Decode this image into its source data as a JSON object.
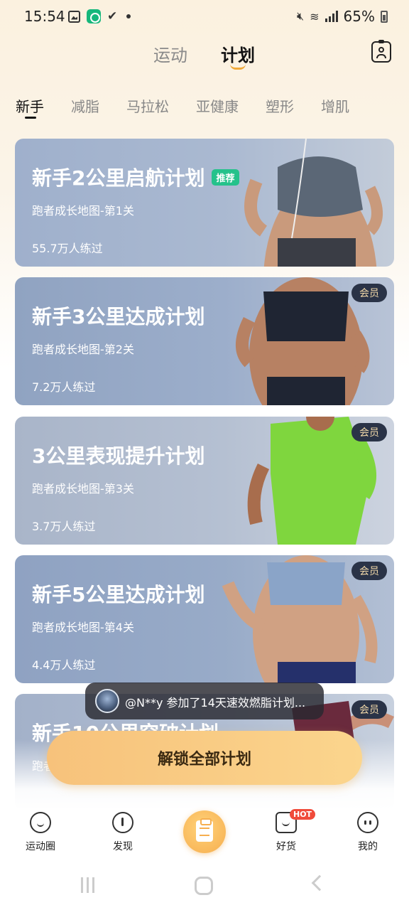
{
  "status_bar": {
    "time": "15:54",
    "battery": "65%",
    "icons_left": [
      "gallery-icon",
      "app-icon",
      "check-icon",
      "dot-icon"
    ],
    "icons_right": [
      "mute-icon",
      "wifi-icon",
      "signal-icon",
      "battery-icon"
    ]
  },
  "header": {
    "tabs": [
      {
        "label": "运动",
        "active": false
      },
      {
        "label": "计划",
        "active": true
      }
    ],
    "profile_icon": "profile-card-icon"
  },
  "categories": [
    {
      "label": "新手",
      "active": true
    },
    {
      "label": "减脂",
      "active": false
    },
    {
      "label": "马拉松",
      "active": false
    },
    {
      "label": "亚健康",
      "active": false
    },
    {
      "label": "塑形",
      "active": false
    },
    {
      "label": "增肌",
      "active": false
    }
  ],
  "plans": [
    {
      "title": "新手2公里启航计划",
      "tag": "推荐",
      "subtitle": "跑者成长地图-第1关",
      "count": "55.7万人练过",
      "badge": ""
    },
    {
      "title": "新手3公里达成计划",
      "tag": "",
      "subtitle": "跑者成长地图-第2关",
      "count": "7.2万人练过",
      "badge": "会员"
    },
    {
      "title": "3公里表现提升计划",
      "tag": "",
      "subtitle": "跑者成长地图-第3关",
      "count": "3.7万人练过",
      "badge": "会员"
    },
    {
      "title": "新手5公里达成计划",
      "tag": "",
      "subtitle": "跑者成长地图-第4关",
      "count": "4.4万人练过",
      "badge": "会员"
    },
    {
      "title": "新手10公里突破计划",
      "tag": "",
      "subtitle": "跑者",
      "count": "",
      "badge": "会员"
    }
  ],
  "toast": {
    "text": "@N**y 参加了14天速效燃脂计划..."
  },
  "unlock_button": {
    "label": "解锁全部计划"
  },
  "bottom_nav": {
    "items": [
      {
        "label": "运动圈",
        "icon": "chat-bubble-icon"
      },
      {
        "label": "发现",
        "icon": "compass-icon"
      },
      {
        "label": "",
        "icon": "plan-clipboard-icon"
      },
      {
        "label": "好货",
        "icon": "cart-icon"
      },
      {
        "label": "我的",
        "icon": "face-icon"
      }
    ],
    "hot_badge": "HOT"
  },
  "colors": {
    "accent": "#f6ae4e",
    "recommend_tag": "#25c28b",
    "member_badge_bg": "#2a3347",
    "member_badge_text": "#f2d9a9",
    "hot_badge": "#f04b3a"
  }
}
